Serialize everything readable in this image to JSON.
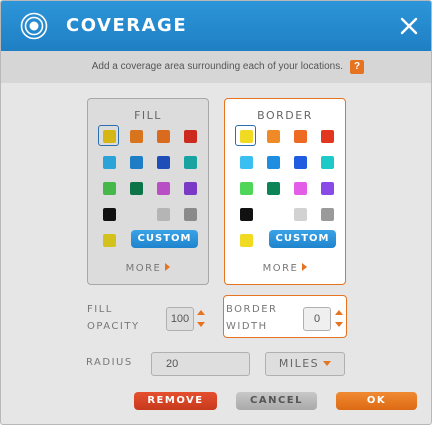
{
  "header": {
    "title": "COVERAGE",
    "logo_icon": "target-rings-icon",
    "close_icon": "close-icon",
    "colors": {
      "background": "#2188cf",
      "text": "#ffffff"
    }
  },
  "subbar": {
    "text": "Add a coverage area surrounding each of your locations.",
    "help": "?"
  },
  "fill": {
    "title": "FILL",
    "selected_index": 0,
    "swatches": [
      "#d4b715",
      "#d8741e",
      "#da6a1e",
      "#cc2a1e",
      "#2ba2d8",
      "#1d7ec6",
      "#1e4fb8",
      "#18a3a0",
      "#46b849",
      "#0c7448",
      "#b94fc4",
      "#7b3ac6",
      "#111111",
      "#dcdcdc",
      "#b5b5b5",
      "#8a8a8a",
      "#d4c21c"
    ],
    "custom_label": "CUSTOM",
    "more_label": "MORE"
  },
  "border": {
    "title": "BORDER",
    "selected_index": 0,
    "swatches": [
      "#f1da22",
      "#f08a26",
      "#ee6a22",
      "#e2361f",
      "#3bbef0",
      "#1f8de0",
      "#1f5ce0",
      "#1ccbc8",
      "#4fd659",
      "#0b8457",
      "#e35ee6",
      "#8a4ae8",
      "#111111",
      "#ffffff",
      "#d2d2d2",
      "#9a9a9a",
      "#f1da22"
    ],
    "custom_label": "CUSTOM",
    "more_label": "MORE"
  },
  "fill_opacity": {
    "label_line1": "FILL",
    "label_line2": "OPACITY",
    "value": "100"
  },
  "border_width": {
    "label_line1": "BORDER",
    "label_line2": "WIDTH",
    "value": "0"
  },
  "radius": {
    "label": "RADIUS",
    "value": "20",
    "units": "MILES"
  },
  "buttons": {
    "remove": "REMOVE",
    "cancel": "CANCEL",
    "ok": "OK"
  },
  "accent_color": "#e6731f"
}
